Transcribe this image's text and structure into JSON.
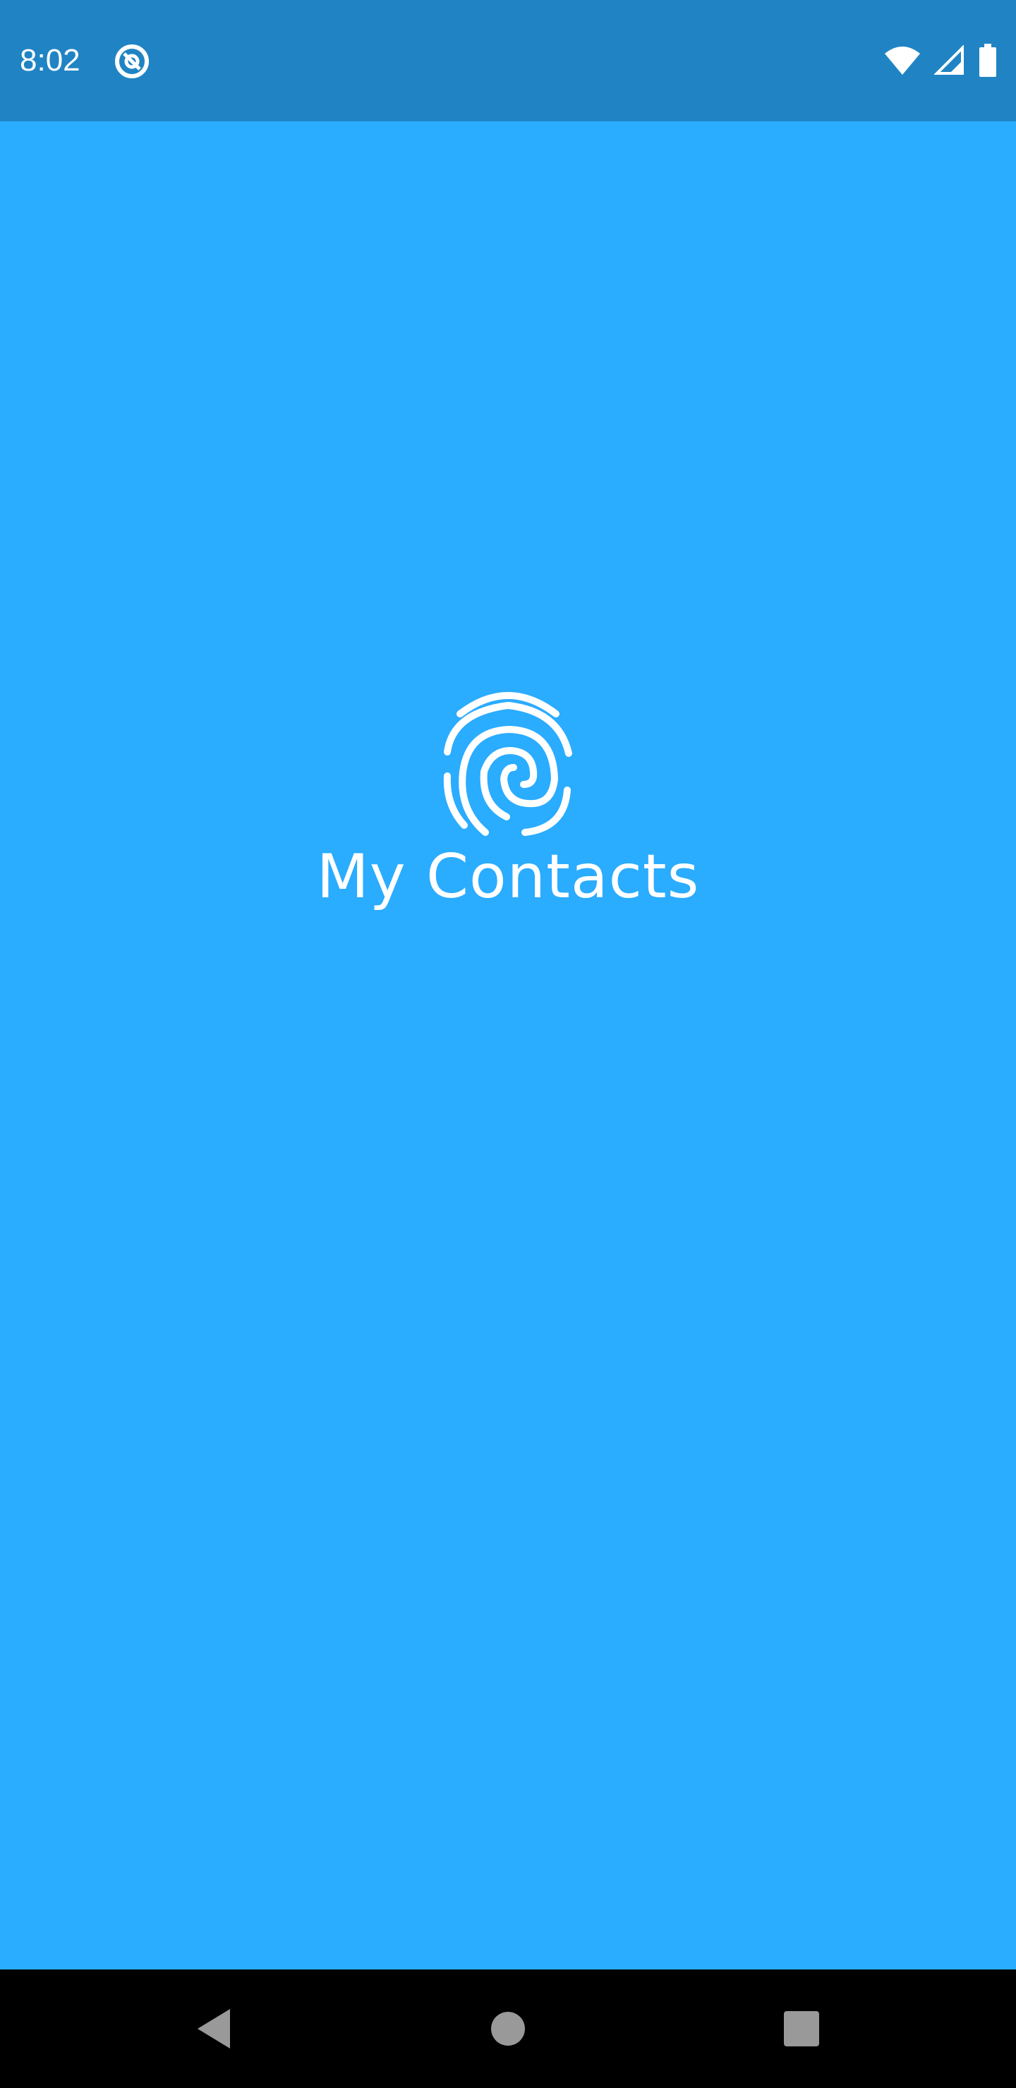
{
  "status_bar": {
    "time": "8:02",
    "notification_icon": "at-sign-icon",
    "icons": [
      "wifi-icon",
      "cell-signal-icon",
      "battery-icon"
    ],
    "background": "#2084c4"
  },
  "splash": {
    "logo_icon": "fingerprint-icon",
    "title": "My Contacts",
    "background": "#2aacff"
  },
  "nav_bar": {
    "buttons": [
      "back-button",
      "home-button",
      "recents-button"
    ],
    "background": "#000000"
  }
}
